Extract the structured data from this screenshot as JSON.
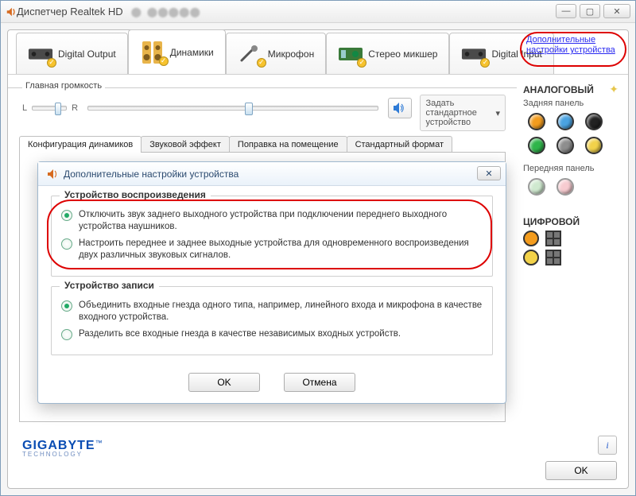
{
  "window": {
    "title": "Диспетчер Realtek HD"
  },
  "tabs": {
    "digital_output": "Digital Output",
    "speakers": "Динамики",
    "mic": "Микрофон",
    "stereo_mixer": "Стерео микшер",
    "digital_input": "Digital Input"
  },
  "extra_link": "Дополнительные настройки устройства",
  "volume": {
    "group_label": "Главная громкость",
    "l": "L",
    "r": "R"
  },
  "default_button": "Задать стандартное устройство",
  "subtabs": {
    "config": "Конфигурация динамиков",
    "effect": "Звуковой эффект",
    "room": "Поправка на помещение",
    "format": "Стандартный формат"
  },
  "modal": {
    "title": "Дополнительные настройки устройства",
    "playback_legend": "Устройство воспроизведения",
    "playback_opt1": "Отключить звук заднего выходного устройства при подключении переднего выходного устройства наушников.",
    "playback_opt2": "Настроить переднее и заднее выходные устройства для одновременного воспроизведения двух различных звуковых сигналов.",
    "record_legend": "Устройство записи",
    "record_opt1": "Объединить входные гнезда одного типа, например, линейного входа и микрофона в качестве входного устройства.",
    "record_opt2": "Разделить все входные гнезда в качестве независимых входных устройств.",
    "ok": "OK",
    "cancel": "Отмена"
  },
  "right_panel": {
    "analog": "АНАЛОГОВЫЙ",
    "back_panel": "Задняя панель",
    "front_panel": "Передняя панель",
    "digital": "ЦИФРОВОЙ"
  },
  "brand": {
    "name": "GIGABYTE",
    "sub": "TECHNOLOGY"
  },
  "footer_ok": "OK",
  "info_icon": "i",
  "jacks": {
    "back": [
      "#f39c1e",
      "#4aa3e2",
      "#222222",
      "#2fb54a",
      "#8e8e8e",
      "#f2d24a"
    ],
    "front": [
      "#ddd",
      "#f7bdbf"
    ],
    "digital": [
      "#f39c1e",
      "#f2d24a"
    ]
  }
}
